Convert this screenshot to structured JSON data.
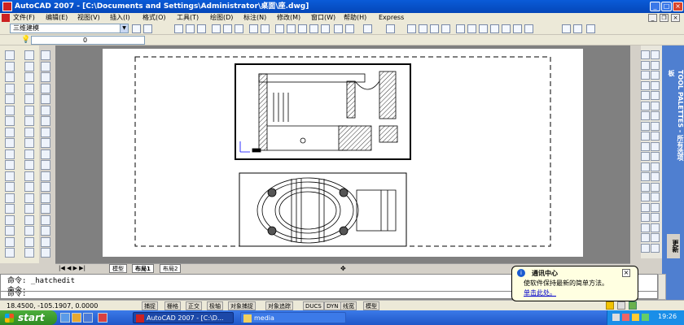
{
  "window": {
    "title": "AutoCAD 2007 - [C:\\Documents and Settings\\Administrator\\桌面\\座.dwg]"
  },
  "menu": [
    "文件(F)",
    "编辑(E)",
    "视图(V)",
    "插入(I)",
    "格式(O)",
    "工具(T)",
    "绘图(D)",
    "标注(N)",
    "修改(M)",
    "窗口(W)",
    "帮助(H)",
    "Express"
  ],
  "toolbar": {
    "workspace": "三维建模",
    "layer": "0"
  },
  "layout_tabs": [
    "模型",
    "布局1",
    "布局2"
  ],
  "command": {
    "line1": "命令: _hatchedit",
    "line2": "命令:",
    "line3": "命令:"
  },
  "status": {
    "coords": "18.4500, -105.1907, 0.0000",
    "buttons": [
      "捕捉",
      "栅格",
      "正交",
      "极轴",
      "对象捕捉",
      "对象追踪",
      "DUCS",
      "DYN",
      "线宽",
      "模型"
    ]
  },
  "balloon": {
    "title": "通讯中心",
    "body": "使软件保持最新的简单方法。",
    "link": "单击此处。"
  },
  "palette": {
    "title": "TOOL PALETTES - 所有选项板",
    "tab": "更新"
  },
  "taskbar": {
    "start": "start",
    "tasks": [
      "AutoCAD 2007 - [C:\\D...",
      "media"
    ],
    "clock": "19:26"
  },
  "colors": {
    "title_bar": "#0a5bd8",
    "taskbar": "#2a64d8",
    "start": "#3c9c2e",
    "model_bg": "#808080"
  }
}
